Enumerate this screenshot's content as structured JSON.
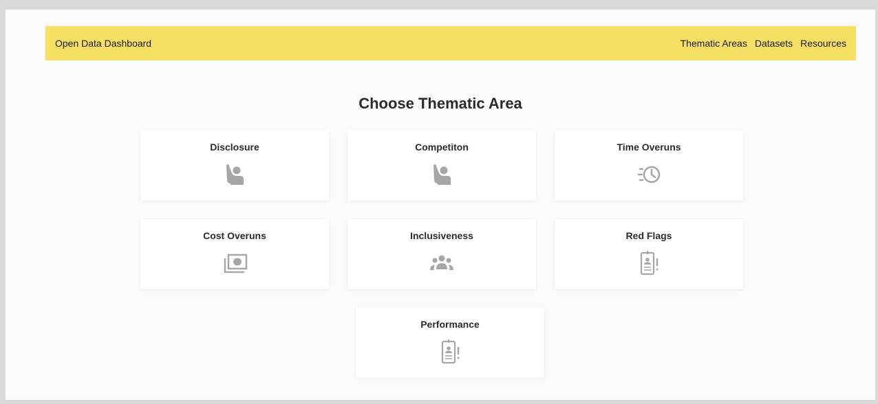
{
  "navbar": {
    "brand": "Open Data Dashboard",
    "links": [
      "Thematic Areas",
      "Datasets",
      "Resources"
    ]
  },
  "page": {
    "title": "Choose Thematic Area"
  },
  "cards": [
    {
      "label": "Disclosure",
      "icon": "raised-hand-person-icon"
    },
    {
      "label": "Competiton",
      "icon": "raised-hand-person-icon"
    },
    {
      "label": "Time Overuns",
      "icon": "fast-clock-icon"
    },
    {
      "label": "Cost Overuns",
      "icon": "cash-stack-icon"
    },
    {
      "label": "Inclusiveness",
      "icon": "group-people-icon"
    },
    {
      "label": "Red Flags",
      "icon": "id-badge-alert-icon"
    },
    {
      "label": "Performance",
      "icon": "id-badge-alert-icon"
    }
  ],
  "colors": {
    "navbar_bg": "#f5e064",
    "icon_gray": "#a6a6a6",
    "page_bg": "#fafafa"
  }
}
